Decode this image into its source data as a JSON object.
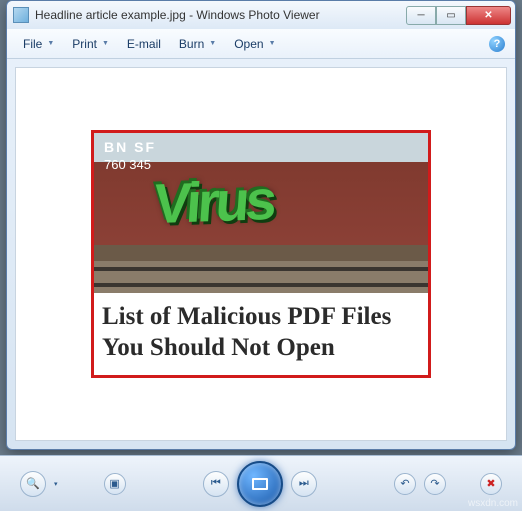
{
  "window": {
    "title": "Headline article example.jpg - Windows Photo Viewer"
  },
  "menu": {
    "file": "File",
    "print": "Print",
    "email": "E-mail",
    "burn": "Burn",
    "open": "Open"
  },
  "image": {
    "railroad_mark": "BN  SF",
    "car_number": "760 345",
    "graffiti_text": "Virus",
    "headline": "List of Malicious PDF Files You Should Not Open"
  },
  "watermark": "wsxdn.com"
}
